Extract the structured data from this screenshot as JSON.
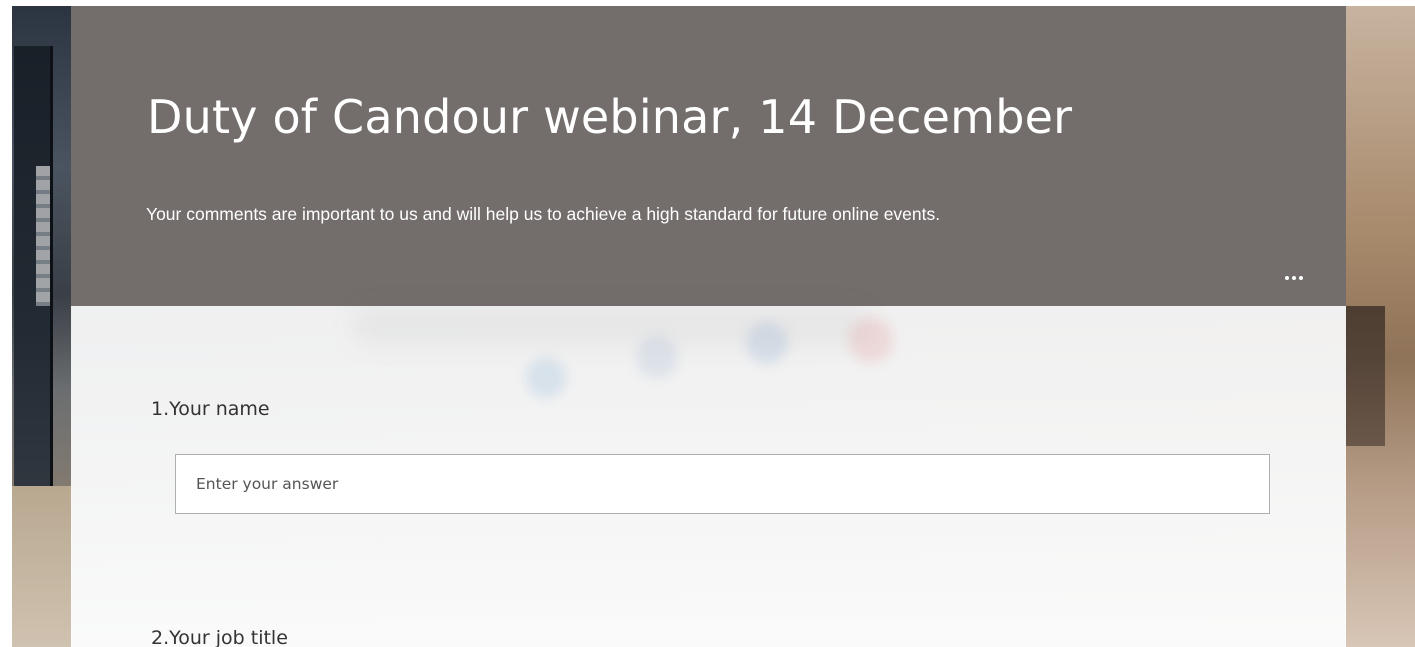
{
  "form": {
    "title": "Duty of Candour webinar, 14 December",
    "description": "Your comments are important to us and will help us to achieve a high standard for future online events.",
    "more_options_icon": "more-horizontal-icon",
    "header_color": "#736d6c"
  },
  "questions": [
    {
      "number": "1.",
      "label": "Your name",
      "placeholder": "Enter your answer"
    },
    {
      "number": "2.",
      "label": "Your job title"
    }
  ]
}
